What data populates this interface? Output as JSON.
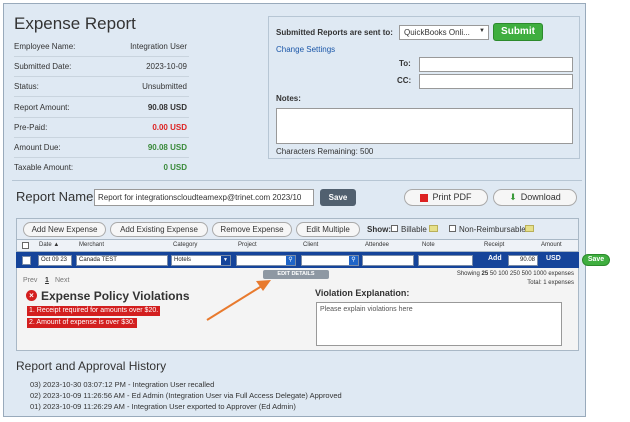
{
  "title": "Expense Report",
  "summary": {
    "employee_label": "Employee Name:",
    "employee": "Integration User",
    "submitted_label": "Submitted Date:",
    "submitted": "2023-10-09",
    "status_label": "Status:",
    "status": "Unsubmitted",
    "amount_label": "Report Amount:",
    "amount": "90.08 USD",
    "prepaid_label": "Pre-Paid:",
    "prepaid": "0.00 USD",
    "due_label": "Amount Due:",
    "due": "90.08 USD",
    "taxable_label": "Taxable Amount:",
    "taxable": "0 USD"
  },
  "submit_panel": {
    "sent_to_label": "Submitted Reports are sent to:",
    "destination": "QuickBooks Onli...",
    "submit_label": "Submit",
    "change_settings": "Change Settings",
    "to_label": "To:",
    "cc_label": "CC:",
    "notes_label": "Notes:",
    "chars_remaining": "Characters Remaining: 500"
  },
  "report_name": {
    "label": "Report Name",
    "value": "Report for integrationscloudteamexp@trinet.com 2023/10",
    "save_label": "Save",
    "print_label": "Print PDF",
    "download_label": "Download"
  },
  "toolbar": {
    "add_new": "Add New Expense",
    "add_existing": "Add Existing Expense",
    "remove": "Remove Expense",
    "edit_multiple": "Edit Multiple",
    "show_label": "Show:",
    "billable": "Billable",
    "non_reimbursable": "Non-Reimbursable"
  },
  "columns": [
    "Date ▲",
    "Merchant",
    "Category",
    "Project",
    "Client",
    "Attendee",
    "Note",
    "Receipt",
    "Amount"
  ],
  "row": {
    "date": "Oct 09 23",
    "merchant": "Canada TEST",
    "category": "Hotels",
    "receipt": "Add",
    "amount": "90.08",
    "currency": "USD",
    "save_label": "Save"
  },
  "details": {
    "edit_details": "EDIT DETAILS",
    "prev": "Prev",
    "page": "1",
    "next": "Next",
    "showing": "Showing",
    "page_sizes": [
      "25",
      "50",
      "100",
      "250",
      "500",
      "1000"
    ],
    "expenses": "expenses",
    "total": "Total: 1 expenses",
    "violations_title": "Expense Policy Violations",
    "violations": [
      "1. Receipt required for amounts over $20.",
      "2. Amount of expense is over $30."
    ],
    "explanation_label": "Violation Explanation:",
    "explanation_placeholder": "Please explain violations here"
  },
  "history": {
    "title": "Report and Approval History",
    "entries": [
      "03) 2023-10-30 03:07:12 PM - Integration User recalled",
      "02) 2023-10-09 11:26:56 AM - Ed Admin (Integration User via Full Access Delegate) Approved",
      "01) 2023-10-09 11:26:29 AM - Integration User exported to Approver (Ed Admin)"
    ]
  },
  "colors": {
    "accent_blue": "#15449a",
    "green": "#3fae3f",
    "violation_red": "#d31f1f",
    "arrow": "#e87a2e"
  }
}
